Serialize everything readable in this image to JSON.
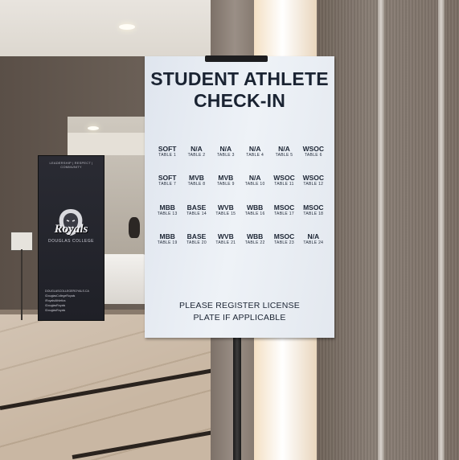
{
  "sign": {
    "title_line1": "STUDENT ATHLETE",
    "title_line2": "CHECK-IN",
    "tables": [
      {
        "code": "SOFT",
        "table": "TABLE 1"
      },
      {
        "code": "N/A",
        "table": "TABLE 2"
      },
      {
        "code": "N/A",
        "table": "TABLE 3"
      },
      {
        "code": "N/A",
        "table": "TABLE 4"
      },
      {
        "code": "N/A",
        "table": "TABLE 5"
      },
      {
        "code": "WSOC",
        "table": "TABLE 6"
      },
      {
        "code": "SOFT",
        "table": "TABLE 7"
      },
      {
        "code": "MVB",
        "table": "TABLE 8"
      },
      {
        "code": "MVB",
        "table": "TABLE 9"
      },
      {
        "code": "N/A",
        "table": "TABLE 10"
      },
      {
        "code": "WSOC",
        "table": "TABLE 11"
      },
      {
        "code": "WSOC",
        "table": "TABLE 12"
      },
      {
        "code": "MBB",
        "table": "TABLE 13"
      },
      {
        "code": "BASE",
        "table": "TABLE 14"
      },
      {
        "code": "WVB",
        "table": "TABLE 15"
      },
      {
        "code": "WBB",
        "table": "TABLE 16"
      },
      {
        "code": "MSOC",
        "table": "TABLE 17"
      },
      {
        "code": "MSOC",
        "table": "TABLE 18"
      },
      {
        "code": "MBB",
        "table": "TABLE 19"
      },
      {
        "code": "BASE",
        "table": "TABLE 20"
      },
      {
        "code": "WVB",
        "table": "TABLE 21"
      },
      {
        "code": "WBB",
        "table": "TABLE 22"
      },
      {
        "code": "MSOC",
        "table": "TABLE 23"
      },
      {
        "code": "N/A",
        "table": "TABLE 24"
      }
    ],
    "footer_line1": "PLEASE REGISTER LICENSE",
    "footer_line2": "PLATE IF APPLICABLE"
  },
  "banner": {
    "tagline": "LEADERSHIP | RESPECT | COMMUNITY",
    "team": "Royals",
    "college": "DOUGLAS COLLEGE",
    "links": [
      "DOUGLASCOLLEGEROYALS.CA",
      "/DouglasCollegeRoyals",
      "/RoyalsAthletics",
      "/DouglasRoyals",
      "/DouglasRoyals"
    ]
  },
  "colors": {
    "sign_text": "#1a2332",
    "sign_background": "#e8edf3",
    "banner_background": "#24252c"
  }
}
